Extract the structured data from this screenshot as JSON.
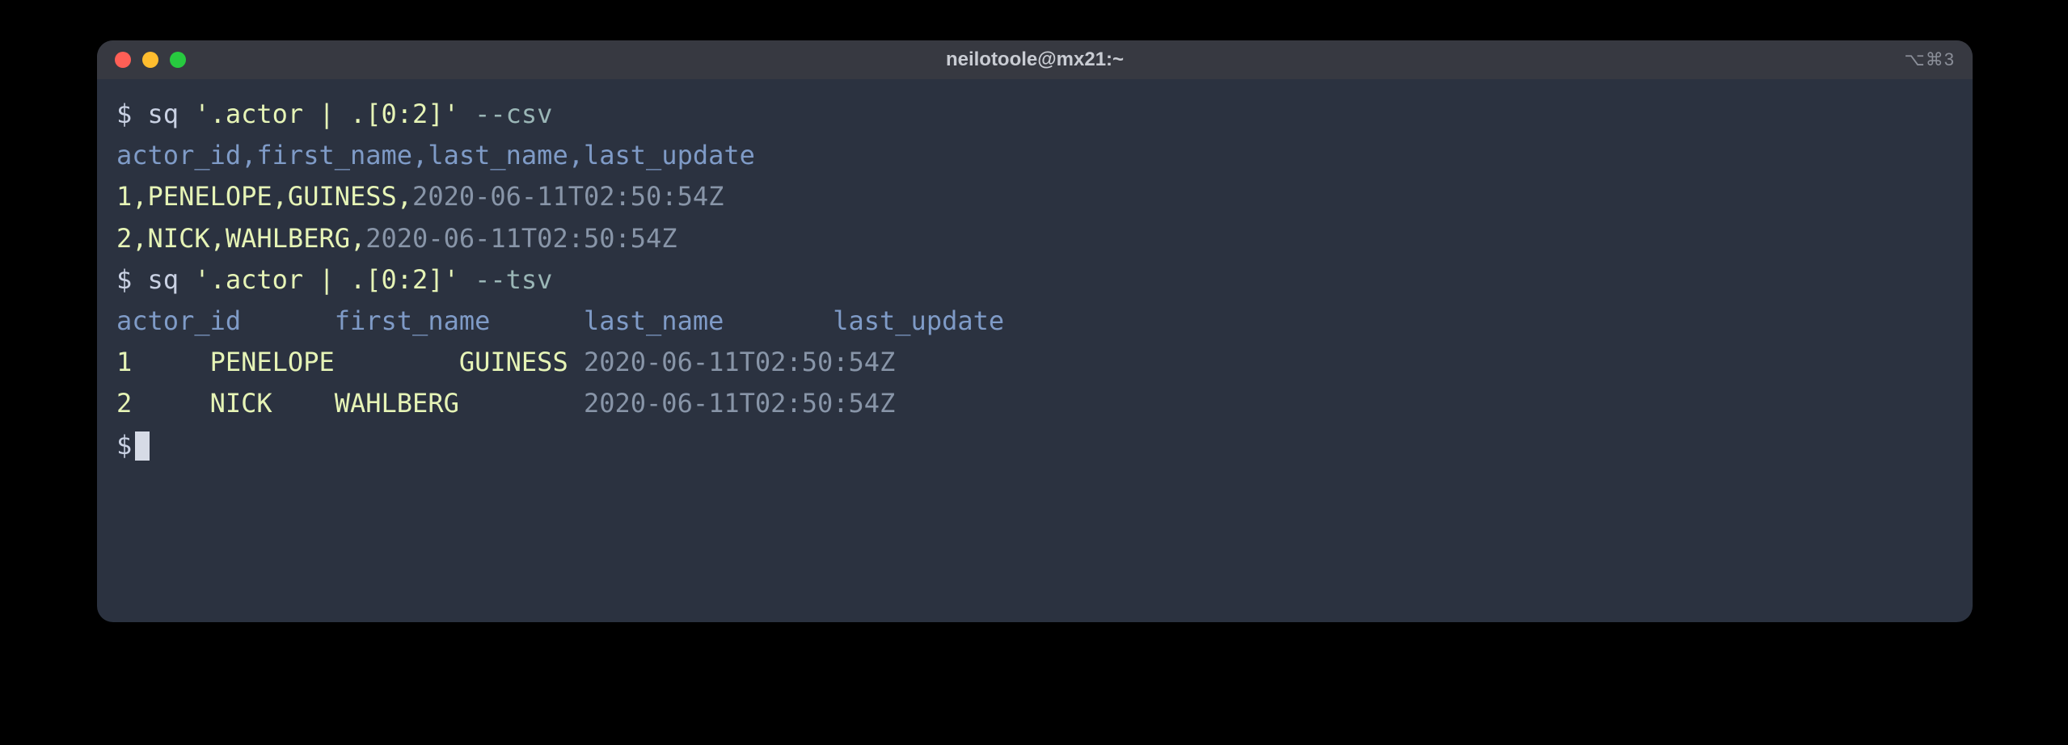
{
  "window": {
    "title": "neilotoole@mx21:~",
    "right_indicator": "⌥⌘3"
  },
  "prompt": "$",
  "lines": {
    "cmd1_a": " sq ",
    "cmd1_b": "'.actor | .[0:2]'",
    "cmd1_c": " ",
    "cmd1_d": "--csv",
    "csv_header": "actor_id,first_name,last_name,last_update",
    "csv_row1_a": "1,PENELOPE,GUINESS,",
    "csv_row1_b": "2020-06-11T02:50:54Z",
    "csv_row2_a": "2,NICK,WAHLBERG,",
    "csv_row2_b": "2020-06-11T02:50:54Z",
    "cmd2_a": " sq ",
    "cmd2_b": "'.actor | .[0:2]'",
    "cmd2_c": " ",
    "cmd2_d": "--tsv",
    "tsv_header": "actor_id      first_name      last_name       last_update",
    "tsv_row1_a": "1     PENELOPE        GUINESS ",
    "tsv_row1_b": "2020-06-11T02:50:54Z",
    "tsv_row2_a": "2     NICK    WAHLBERG        ",
    "tsv_row2_b": "2020-06-11T02:50:54Z"
  }
}
